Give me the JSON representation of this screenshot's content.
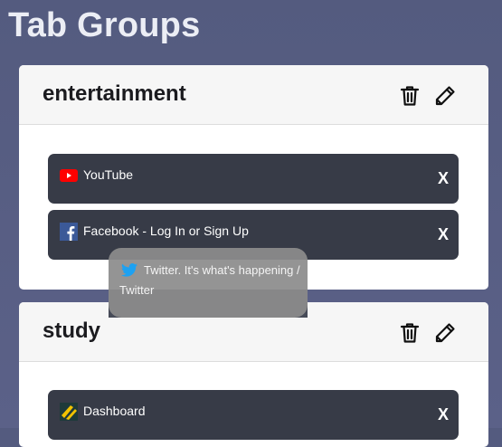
{
  "page": {
    "title": "Tab Groups"
  },
  "groups": [
    {
      "name": "entertainment",
      "tabs": [
        {
          "title": "YouTube",
          "icon": "youtube-icon",
          "close_label": "X"
        },
        {
          "title": "Facebook - Log In or Sign Up",
          "icon": "facebook-icon",
          "close_label": "X"
        }
      ]
    },
    {
      "name": "study",
      "tabs": [
        {
          "title": "Dashboard",
          "icon": "dashboard-icon",
          "close_label": "X"
        }
      ]
    }
  ],
  "dragging_tab": {
    "title": "Twitter. It's what's happening / Twitter",
    "icon": "twitter-icon"
  },
  "icons": {
    "delete": "trash-icon",
    "edit": "pencil-icon"
  },
  "colors": {
    "background": "#575d83",
    "tab": "#373b47",
    "youtube": "#ff0000",
    "facebook": "#3b5998",
    "twitter": "#1da1f2"
  }
}
